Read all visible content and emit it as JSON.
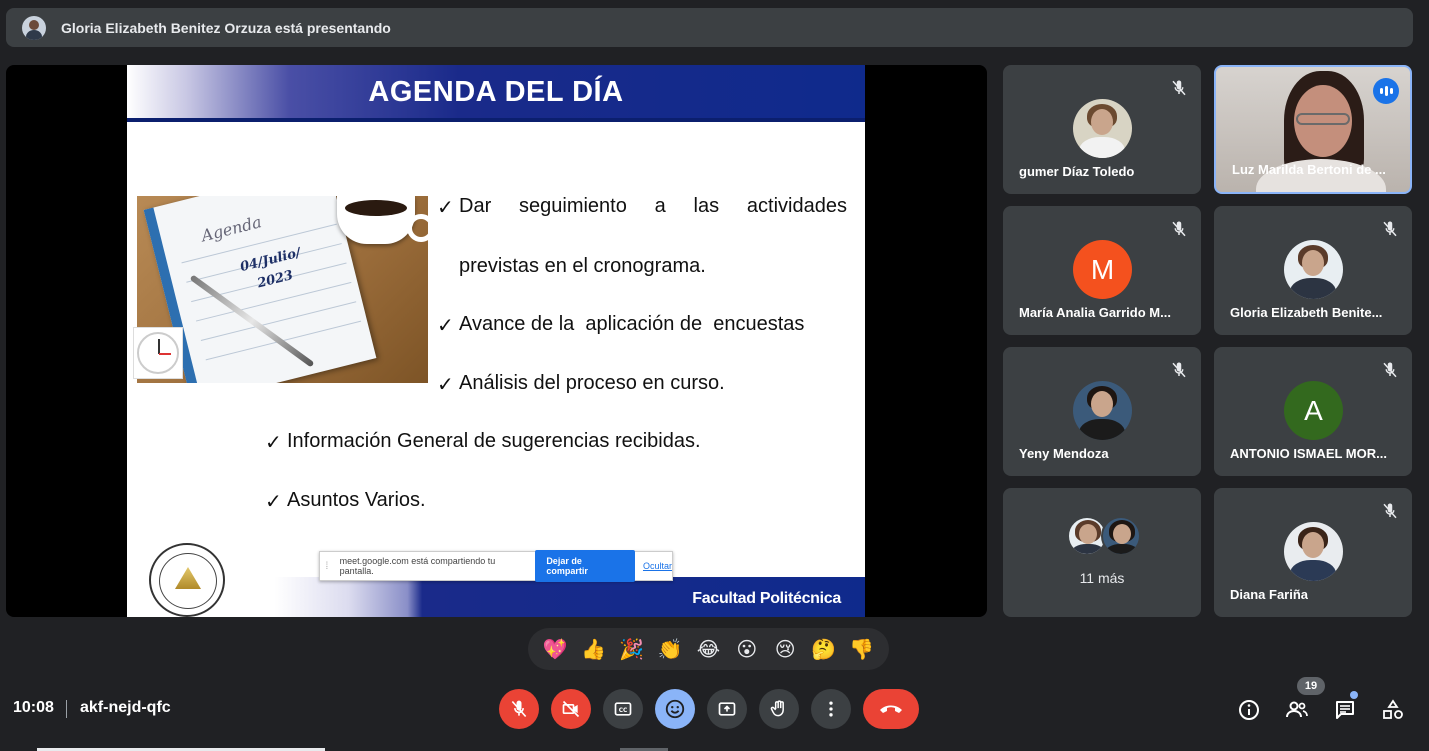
{
  "banner": {
    "presenter_text": "Gloria Elizabeth Benitez Orzuza está presentando"
  },
  "slide": {
    "title": "AGENDA DEL DÍA",
    "image_text": {
      "word": "Agenda",
      "date_line1": "04/Julio/",
      "date_line2": "2023"
    },
    "bullets": [
      {
        "check": "✓",
        "words": [
          "Dar",
          "seguimiento",
          "a",
          "las",
          "actividades"
        ],
        "continuation": "previstas en el cronograma."
      },
      {
        "check": "✓",
        "text": "Avance de la  aplicación de  encuestas"
      },
      {
        "check": "✓",
        "text": "Análisis del proceso en curso."
      },
      {
        "check": "✓",
        "text": "Información General de sugerencias recibidas."
      },
      {
        "check": "✓",
        "text": "Asuntos Varios."
      }
    ],
    "footer_text": "Facultad Politécnica"
  },
  "share_bar": {
    "message": "meet.google.com está compartiendo tu pantalla.",
    "stop_label": "Dejar de compartir",
    "hide_label": "Ocultar"
  },
  "participants": [
    {
      "name": "gumer Díaz Toledo",
      "muted": true
    },
    {
      "name": "Luz Marilda Bertoni de ...",
      "speaking": true
    },
    {
      "name": "María Analia Garrido M...",
      "initial": "M",
      "color": "#f4511e",
      "muted": true
    },
    {
      "name": "Gloria Elizabeth Benite...",
      "muted": true
    },
    {
      "name": "Yeny Mendoza",
      "muted": true
    },
    {
      "name": "ANTONIO ISMAEL MOR...",
      "initial": "A",
      "color": "#33691e",
      "muted": true
    },
    {
      "more_label": "11 más"
    },
    {
      "name": "Diana Fariña",
      "muted": true
    }
  ],
  "reactions": [
    "💖",
    "👍",
    "🎉",
    "👏",
    "😂",
    "😮",
    "😢",
    "🤔",
    "👎"
  ],
  "bottom_bar": {
    "time": "10:08",
    "meeting_code": "akf-nejd-qfc",
    "people_count": "19"
  },
  "colors": {
    "accent_blue": "#8ab4f8",
    "danger_red": "#ea4335",
    "tile_bg": "#3c4043"
  }
}
